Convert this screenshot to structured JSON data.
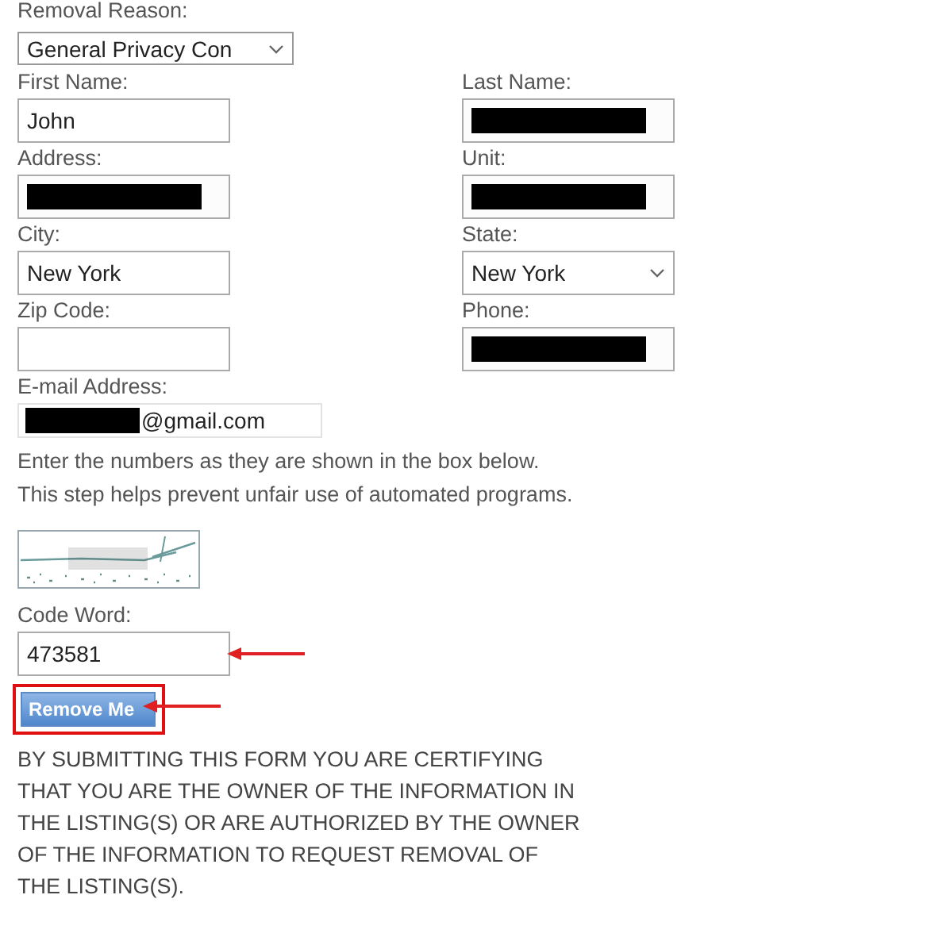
{
  "removal_reason": {
    "label": "Removal Reason:",
    "value": "General Privacy Con"
  },
  "rows": [
    {
      "left": {
        "label": "First Name:",
        "kind": "text",
        "value": "John"
      },
      "right": {
        "label": "Last Name:",
        "kind": "text",
        "redacted": true
      }
    },
    {
      "left": {
        "label": "Address:",
        "kind": "text",
        "redacted": true
      },
      "right": {
        "label": "Unit:",
        "kind": "text",
        "redacted": true
      }
    },
    {
      "left": {
        "label": "City:",
        "kind": "text",
        "value": "New York"
      },
      "right": {
        "label": "State:",
        "kind": "select",
        "value": "New York"
      }
    },
    {
      "left": {
        "label": "Zip Code:",
        "kind": "text"
      },
      "right": {
        "label": "Phone:",
        "kind": "text",
        "redacted": true
      }
    }
  ],
  "email": {
    "label": "E-mail Address:",
    "value": "@gmail.com",
    "redacted": true
  },
  "instructions": [
    "Enter the numbers as they are shown in the box below.",
    "This step helps prevent unfair use of automated programs."
  ],
  "code_word": {
    "label": "Code Word:",
    "value": "473581",
    "arrow": true
  },
  "submit": {
    "label": "Remove Me",
    "highlighted": true,
    "arrow": true
  },
  "disclaimer": [
    "BY SUBMITTING THIS FORM YOU ARE CERTIFYING",
    "THAT YOU ARE THE OWNER OF THE INFORMATION IN",
    "THE LISTING(S) OR ARE AUTHORIZED BY THE OWNER",
    "OF THE INFORMATION TO REQUEST REMOVAL OF",
    "THE LISTING(S)."
  ]
}
